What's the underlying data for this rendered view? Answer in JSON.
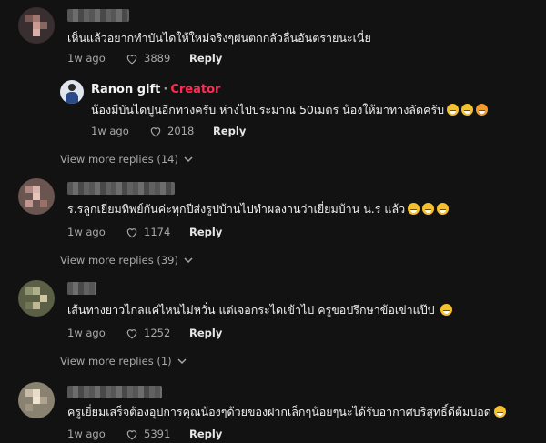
{
  "comments": [
    {
      "text": "เห็นแล้วอยากทำบันไดให้ใหม่จริงๆฝนตกกลัวลื่นอันตรายนะเนี่ย",
      "time": "1w ago",
      "likes": "3889",
      "reply_label": "Reply"
    },
    {
      "text": "ร.รลูกเยี่ยมทิพย์กันค่ะทุกปีส่งรูปบ้านไปทำผลงานว่าเยี่ยมบ้าน น.ร แล้ว",
      "time": "1w ago",
      "likes": "1174",
      "reply_label": "Reply",
      "view_more": "View more replies (39)"
    },
    {
      "text": "เส้นทางยาวไกลแค่ไหนไม่หวั่น แต่เจอกระไดเข้าไป ครูขอปรึกษาข้อเข่าแป๊ป",
      "time": "1w ago",
      "likes": "1252",
      "reply_label": "Reply",
      "view_more": "View more replies (1)"
    },
    {
      "text": "ครูเยี่ยมเสร็จต้องอุปการคุณน้องๆด้วยของฝากเล็กๆน้อยๆนะได้รับอากาศบริสุทธิ์ดีต้มปอด",
      "time": "1w ago",
      "likes": "5391",
      "reply_label": "Reply"
    }
  ],
  "creator_reply": {
    "name": "Ranon gift",
    "separator": "·",
    "badge": "Creator",
    "text": "น้องมีบันไดปูนอีกทางครับ ห่างไปประมาณ 50เมตร น้องให้มาทางลัดครับ",
    "time": "1w ago",
    "likes": "2018",
    "reply_label": "Reply"
  },
  "first_view_more": "View more replies (14)",
  "colors": {
    "background": "#121212",
    "creator_badge": "#fe2c55"
  },
  "icons": {
    "like": "heart-outline-icon",
    "expand": "chevron-down-icon"
  }
}
